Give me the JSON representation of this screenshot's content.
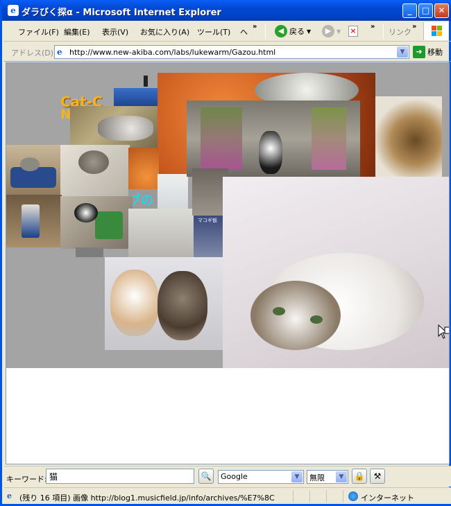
{
  "window": {
    "title": "ダラびく探α - Microsoft Internet Explorer",
    "buttons": {
      "minimize": "_",
      "maximize": "□",
      "close": "✕"
    }
  },
  "menu": {
    "items": [
      "ファイル(F)",
      "編集(E)",
      "表示(V)",
      "お気に入り(A)",
      "ツール(T)",
      "ヘ"
    ],
    "more": "»",
    "back_label": "戻る",
    "links_label": "リンク"
  },
  "address": {
    "label": "アドレス(D)",
    "url": "http://www.new-akiba.com/labs/lukewarm/Gazou.html",
    "go_label": "移動"
  },
  "collage": {
    "overlay_text_1": "Cat-C",
    "overlay_text_2": "N",
    "overlay_text_3": "ブの",
    "label_small": "マコギ仮"
  },
  "search": {
    "keyword_label": "キーワード:",
    "keyword_value": "猫",
    "engine_value": "Google",
    "limit_value": "無限"
  },
  "status": {
    "text": "(残り 16 項目) 画像 http://blog1.musicfield.jp/info/archives/%E7%8C",
    "zone": "インターネット"
  },
  "colors": {
    "titlebar": "#0348d2",
    "chrome": "#ece9d8",
    "collage_bg": "#a4a4a4"
  }
}
